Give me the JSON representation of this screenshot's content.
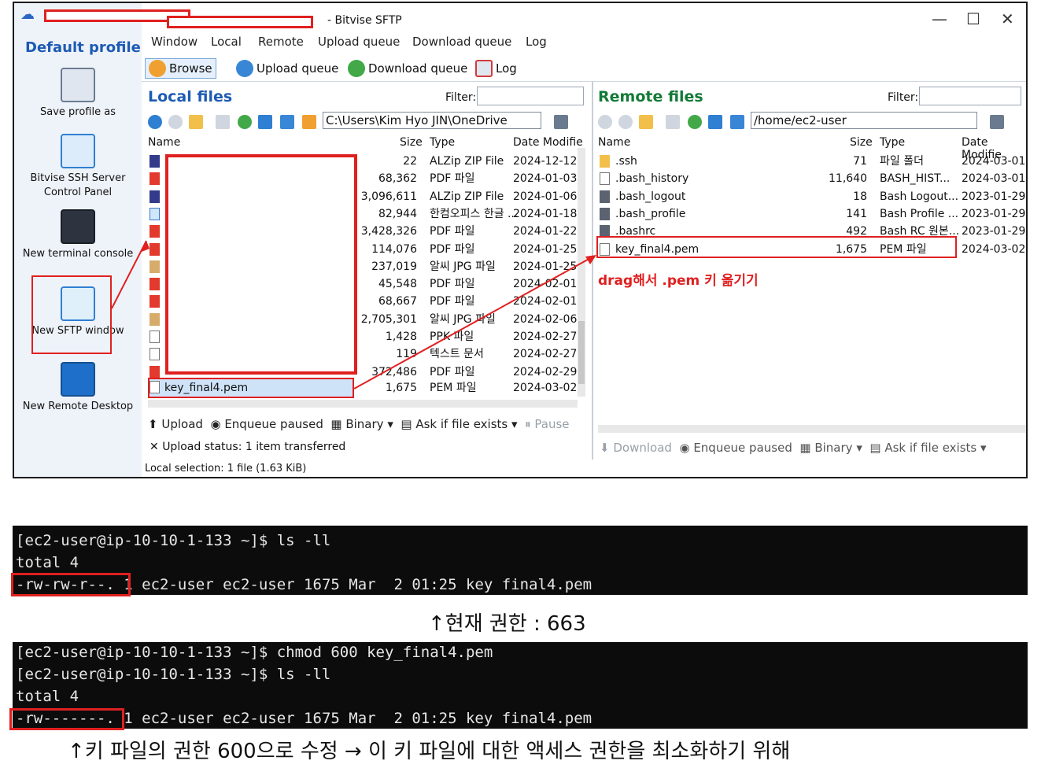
{
  "window": {
    "title_suffix": "- Bitvise SFTP",
    "controls": {
      "minimize": "—",
      "maximize": "☐",
      "close": "✕"
    }
  },
  "profile_panel": {
    "title": "Default profile",
    "items": [
      {
        "label": "Save profile as",
        "icon": "save-profile-icon"
      },
      {
        "label": "Bitvise SSH Server Control Panel",
        "icon": "server-icon"
      },
      {
        "label": "New terminal console",
        "icon": "terminal-icon"
      },
      {
        "label": "New SFTP window",
        "icon": "sftp-window-icon"
      },
      {
        "label": "New Remote Desktop",
        "icon": "remote-desktop-icon"
      }
    ]
  },
  "menu": [
    "Window",
    "Local",
    "Remote",
    "Upload queue",
    "Download queue",
    "Log"
  ],
  "toolbar": [
    "Browse",
    "Upload queue",
    "Download queue",
    "Log"
  ],
  "local": {
    "title": "Local files",
    "filter_label": "Filter:",
    "path": "C:\\Users\\Kim Hyo JIN\\OneDrive",
    "columns": [
      "Name",
      "Size",
      "Type",
      "Date Modifie"
    ],
    "rows": [
      {
        "icon": "zip",
        "size": "22",
        "type": "ALZip ZIP File",
        "date": "2024-12-12"
      },
      {
        "icon": "pdf",
        "size": "68,362",
        "type": "PDF 파일",
        "date": "2024-01-03"
      },
      {
        "icon": "zip",
        "size": "3,096,611",
        "type": "ALZip ZIP File",
        "date": "2024-01-06"
      },
      {
        "icon": "hwp",
        "size": "82,944",
        "type": "한컴오피스 한글 ...",
        "date": "2024-01-18"
      },
      {
        "icon": "pdf",
        "size": "3,428,326",
        "type": "PDF 파일",
        "date": "2024-01-22"
      },
      {
        "icon": "pdf",
        "size": "114,076",
        "type": "PDF 파일",
        "date": "2024-01-25"
      },
      {
        "icon": "jpg",
        "size": "237,019",
        "type": "알씨 JPG 파일",
        "date": "2024-01-25"
      },
      {
        "icon": "pdf",
        "size": "45,548",
        "type": "PDF 파일",
        "date": "2024-02-01"
      },
      {
        "icon": "pdf",
        "size": "68,667",
        "type": "PDF 파일",
        "date": "2024-02-01"
      },
      {
        "icon": "jpg",
        "size": "2,705,301",
        "type": "알씨 JPG 파일",
        "date": "2024-02-06"
      },
      {
        "icon": "file",
        "size": "1,428",
        "type": "PPK 파일",
        "date": "2024-02-27"
      },
      {
        "icon": "file",
        "size": "119",
        "type": "텍스트 문서",
        "date": "2024-02-27"
      },
      {
        "icon": "pdf",
        "size": "372,486",
        "type": "PDF 파일",
        "date": "2024-02-29"
      },
      {
        "icon": "file",
        "name": "key_final4.pem",
        "size": "1,675",
        "type": "PEM 파일",
        "date": "2024-03-02"
      }
    ],
    "bottom_tools": [
      "Upload",
      "Enqueue paused",
      "Binary",
      "Ask if file exists",
      "Pause"
    ],
    "upload_status_label": "Upload status:",
    "upload_status_value": "1 item transferred",
    "local_selection": "Local selection: 1 file (1.63 KiB)"
  },
  "remote": {
    "title": "Remote files",
    "filter_label": "Filter:",
    "path": "/home/ec2-user",
    "columns": [
      "Name",
      "Size",
      "Type",
      "Date Modifie"
    ],
    "rows": [
      {
        "icon": "folder",
        "name": ".ssh",
        "size": "71",
        "type": "파일 폴더",
        "date": "2024-03-01"
      },
      {
        "icon": "file",
        "name": ".bash_history",
        "size": "11,640",
        "type": "BASH_HIST...",
        "date": "2024-03-01"
      },
      {
        "icon": "gear",
        "name": ".bash_logout",
        "size": "18",
        "type": "Bash Logout...",
        "date": "2023-01-29"
      },
      {
        "icon": "gear",
        "name": ".bash_profile",
        "size": "141",
        "type": "Bash Profile ...",
        "date": "2023-01-29"
      },
      {
        "icon": "gear",
        "name": ".bashrc",
        "size": "492",
        "type": "Bash RC 원본...",
        "date": "2023-01-29"
      },
      {
        "icon": "file",
        "name": "key_final4.pem",
        "size": "1,675",
        "type": "PEM 파일",
        "date": "2024-03-02"
      }
    ],
    "bottom_tools": [
      "Download",
      "Enqueue paused",
      "Binary",
      "Ask if file exists"
    ]
  },
  "annotation": "drag해서 .pem 키 옮기기",
  "terminal1": {
    "lines": [
      "[ec2-user@ip-10-10-1-133 ~]$ ls -ll",
      "total 4"
    ],
    "perm": "-rw-rw-r--.",
    "rest": " 1 ec2-user ec2-user 1675 Mar  2 01:25 key final4.pem"
  },
  "caption1": "↑현재 권한 : 663",
  "terminal2": {
    "lines": [
      "[ec2-user@ip-10-10-1-133 ~]$ chmod 600 key_final4.pem",
      "[ec2-user@ip-10-10-1-133 ~]$ ls -ll",
      "total 4"
    ],
    "perm": "-rw-------.",
    "rest": " 1 ec2-user ec2-user 1675 Mar  2 01:25 key final4.pem"
  },
  "caption2": "↑키 파일의 권한 600으로 수정 → 이 키 파일에 대한 액세스 권한을 최소화하기 위해",
  "colors": {
    "accent": "#1d5bb3",
    "remote_title": "#137a37",
    "annotation": "#e02020"
  }
}
